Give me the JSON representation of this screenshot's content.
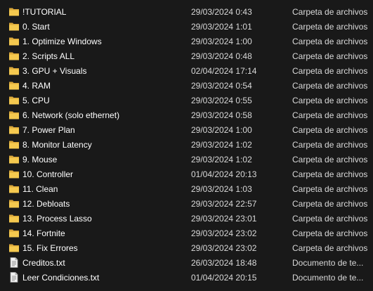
{
  "files": [
    {
      "name": "!TUTORIAL",
      "date": "29/03/2024 0:43",
      "type": "Carpeta de archivos",
      "icon": "folder-icon"
    },
    {
      "name": "0. Start",
      "date": "29/03/2024 1:01",
      "type": "Carpeta de archivos",
      "icon": "folder-icon"
    },
    {
      "name": "1. Optimize Windows",
      "date": "29/03/2024 1:00",
      "type": "Carpeta de archivos",
      "icon": "folder-icon"
    },
    {
      "name": "2. Scripts ALL",
      "date": "29/03/2024 0:48",
      "type": "Carpeta de archivos",
      "icon": "folder-icon"
    },
    {
      "name": "3. GPU + Visuals",
      "date": "02/04/2024 17:14",
      "type": "Carpeta de archivos",
      "icon": "folder-icon"
    },
    {
      "name": "4. RAM",
      "date": "29/03/2024 0:54",
      "type": "Carpeta de archivos",
      "icon": "folder-icon"
    },
    {
      "name": "5. CPU",
      "date": "29/03/2024 0:55",
      "type": "Carpeta de archivos",
      "icon": "folder-icon"
    },
    {
      "name": "6. Network (solo ethernet)",
      "date": "29/03/2024 0:58",
      "type": "Carpeta de archivos",
      "icon": "folder-icon"
    },
    {
      "name": "7. Power Plan",
      "date": "29/03/2024 1:00",
      "type": "Carpeta de archivos",
      "icon": "folder-icon"
    },
    {
      "name": "8. Monitor Latency",
      "date": "29/03/2024 1:02",
      "type": "Carpeta de archivos",
      "icon": "folder-icon"
    },
    {
      "name": "9. Mouse",
      "date": "29/03/2024 1:02",
      "type": "Carpeta de archivos",
      "icon": "folder-icon"
    },
    {
      "name": "10. Controller",
      "date": "01/04/2024 20:13",
      "type": "Carpeta de archivos",
      "icon": "folder-icon"
    },
    {
      "name": "11. Clean",
      "date": "29/03/2024 1:03",
      "type": "Carpeta de archivos",
      "icon": "folder-icon"
    },
    {
      "name": "12. Debloats",
      "date": "29/03/2024 22:57",
      "type": "Carpeta de archivos",
      "icon": "folder-icon"
    },
    {
      "name": "13. Process Lasso",
      "date": "29/03/2024 23:01",
      "type": "Carpeta de archivos",
      "icon": "folder-icon"
    },
    {
      "name": "14. Fortnite",
      "date": "29/03/2024 23:02",
      "type": "Carpeta de archivos",
      "icon": "folder-icon"
    },
    {
      "name": "15. Fix Errores",
      "date": "29/03/2024 23:02",
      "type": "Carpeta de archivos",
      "icon": "folder-icon"
    },
    {
      "name": "Creditos.txt",
      "date": "26/03/2024 18:48",
      "type": "Documento de te...",
      "icon": "text-file-icon"
    },
    {
      "name": "Leer Condiciones.txt",
      "date": "01/04/2024 20:15",
      "type": "Documento de te...",
      "icon": "text-file-icon"
    }
  ],
  "colors": {
    "background": "#191919",
    "folder": "#f0c350",
    "text": "#ffffff",
    "secondary_text": "#d9d9d9"
  }
}
